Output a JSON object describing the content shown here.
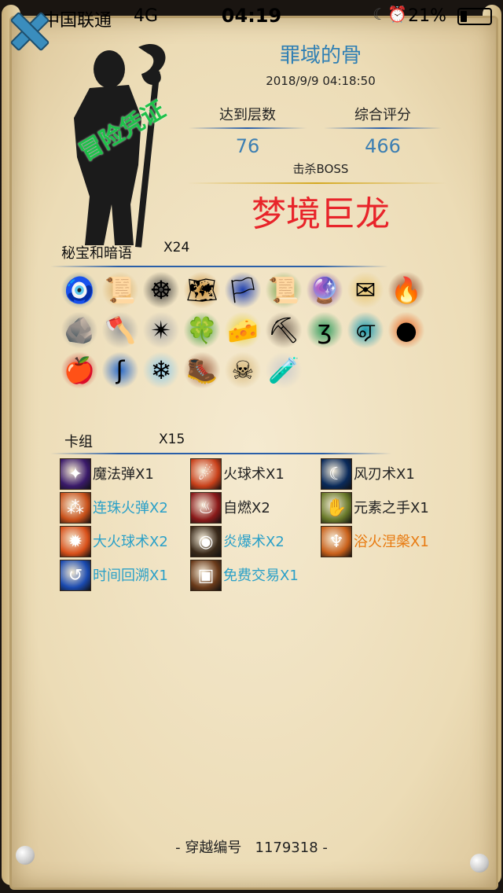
{
  "status_bar": {
    "carrier": "中国联通",
    "network": "4G",
    "time": "04:19",
    "battery": "21%"
  },
  "profile": {
    "name": "罪域的骨",
    "date": "2018/9/9 04:18:50",
    "stamp": "冒险凭证"
  },
  "stats": {
    "floor_label": "达到层数",
    "floor_value": "76",
    "score_label": "综合评分",
    "score_value": "466",
    "boss_label": "击杀BOSS",
    "boss_name": "梦境巨龙"
  },
  "treasures": {
    "title": "秘宝和暗语",
    "count": "X24",
    "items": [
      {
        "icon": "amulet-icon",
        "glyph": "🧿",
        "bg": "#3a6c8c"
      },
      {
        "icon": "scroll-icon",
        "glyph": "📜",
        "bg": "#d9a95a"
      },
      {
        "icon": "triquetra-icon",
        "glyph": "☸",
        "bg": "#3a3a3a"
      },
      {
        "icon": "map-icon",
        "glyph": "🗺",
        "bg": "#c98a2e"
      },
      {
        "icon": "blue-banner-icon",
        "glyph": "🏳",
        "bg": "#1d3fb0"
      },
      {
        "icon": "green-scroll-icon",
        "glyph": "📜",
        "bg": "#6a9a3c"
      },
      {
        "icon": "crystal-tome-icon",
        "glyph": "🔮",
        "bg": "#6a2a9c"
      },
      {
        "icon": "envelope-icon",
        "glyph": "✉",
        "bg": "#e8c56e"
      },
      {
        "icon": "ember-bag-icon",
        "glyph": "🔥",
        "bg": "#8a3a1a"
      },
      {
        "icon": "rock-icon",
        "glyph": "🪨",
        "bg": "#8a8a8a"
      },
      {
        "icon": "axe-icon",
        "glyph": "🪓",
        "bg": "#9a9a9a"
      },
      {
        "icon": "shuriken-icon",
        "glyph": "✴",
        "bg": "#aaaaaa"
      },
      {
        "icon": "clover-icon",
        "glyph": "🍀",
        "bg": "#3a9a3a"
      },
      {
        "icon": "cheese-icon",
        "glyph": "🧀",
        "bg": "#e8d03a"
      },
      {
        "icon": "pickaxe-icon",
        "glyph": "⛏",
        "bg": "#7a6a5a"
      },
      {
        "icon": "green-rune-icon",
        "glyph": "ʒ",
        "bg": "#2a9a5a"
      },
      {
        "icon": "cyan-rune-icon",
        "glyph": "ஏ",
        "bg": "#1a9ab0"
      },
      {
        "icon": "fire-orb-icon",
        "glyph": "●",
        "bg": "#e8601a"
      },
      {
        "icon": "apple-icon",
        "glyph": "🍎",
        "bg": "#c8201a"
      },
      {
        "icon": "blue-sigil-icon",
        "glyph": "ʃ",
        "bg": "#2a6ac8"
      },
      {
        "icon": "frost-orb-icon",
        "glyph": "❄",
        "bg": "#8ac8e8"
      },
      {
        "icon": "boot-icon",
        "glyph": "🥾",
        "bg": "#9a5a3a"
      },
      {
        "icon": "skull-scroll-icon",
        "glyph": "☠",
        "bg": "#d8b87a"
      },
      {
        "icon": "potion-vial-icon",
        "glyph": "🧪",
        "bg": "#cccccc"
      }
    ]
  },
  "deck": {
    "title": "卡组",
    "count": "X15",
    "cards": [
      {
        "label": "魔法弹X1",
        "color": "#222222",
        "icon": "magic-bolt-icon",
        "glyph": "✦",
        "bg": "#3a1a6a"
      },
      {
        "label": "火球术X1",
        "color": "#222222",
        "icon": "fireball-icon",
        "glyph": "☄",
        "bg": "#c8401a"
      },
      {
        "label": "风刃术X1",
        "color": "#222222",
        "icon": "wind-blade-icon",
        "glyph": "☾",
        "bg": "#0a2a5a"
      },
      {
        "label": "连珠火弹X2",
        "color": "#2aa0c8",
        "icon": "chain-fire-icon",
        "glyph": "⁂",
        "bg": "#c8501a"
      },
      {
        "label": "自燃X2",
        "color": "#222222",
        "icon": "self-ignite-icon",
        "glyph": "♨",
        "bg": "#8a1a1a"
      },
      {
        "label": "元素之手X1",
        "color": "#222222",
        "icon": "element-hand-icon",
        "glyph": "✋",
        "bg": "#6a7a2a"
      },
      {
        "label": "大火球术X2",
        "color": "#2aa0c8",
        "icon": "big-fireball-icon",
        "glyph": "✹",
        "bg": "#d8501a"
      },
      {
        "label": "炎爆术X2",
        "color": "#2aa0c8",
        "icon": "pyroblast-icon",
        "glyph": "◉",
        "bg": "#3a2a1a"
      },
      {
        "label": "浴火涅槃X1",
        "color": "#e87a10",
        "icon": "phoenix-icon",
        "glyph": "♆",
        "bg": "#c8601a"
      },
      {
        "label": "时间回溯X1",
        "color": "#2aa0c8",
        "icon": "time-rewind-icon",
        "glyph": "↺",
        "bg": "#1a4ab0"
      },
      {
        "label": "免费交易X1",
        "color": "#2aa0c8",
        "icon": "treasure-chest-icon",
        "glyph": "▣",
        "bg": "#6a3a1a"
      }
    ]
  },
  "footer": {
    "label": "- 穿越编号",
    "number": "1179318 -"
  }
}
